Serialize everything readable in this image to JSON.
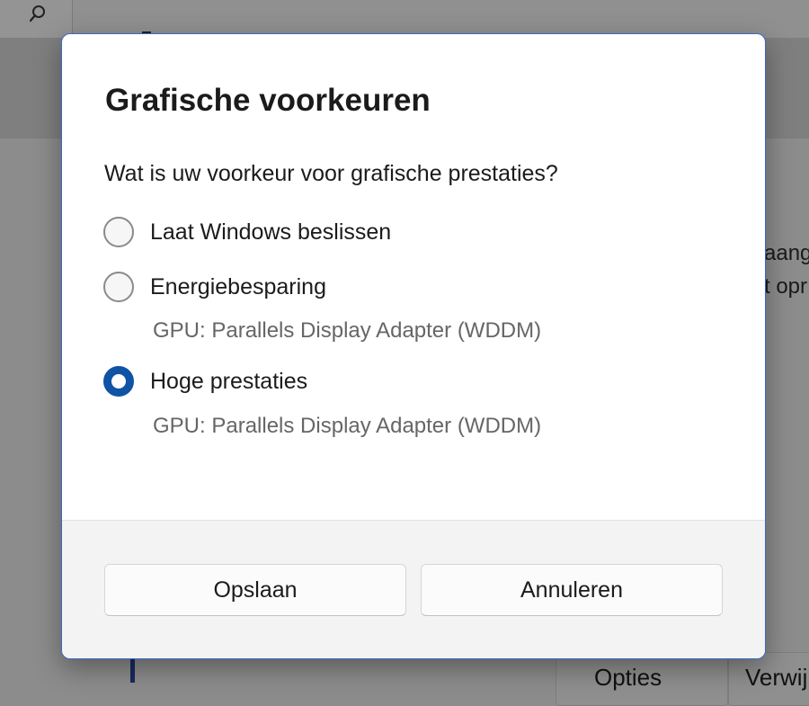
{
  "background": {
    "partial_texts": [
      "aang",
      "t opr"
    ],
    "bottom_buttons": [
      "Opties",
      "Verwij"
    ]
  },
  "dialog": {
    "title": "Grafische voorkeuren",
    "question": "Wat is uw voorkeur voor grafische prestaties?",
    "options": [
      {
        "label": "Laat Windows beslissen",
        "selected": false
      },
      {
        "label": "Energiebesparing",
        "selected": false,
        "gpu": "GPU: Parallels Display Adapter (WDDM)"
      },
      {
        "label": "Hoge prestaties",
        "selected": true,
        "gpu": "GPU: Parallels Display Adapter (WDDM)"
      }
    ],
    "buttons": {
      "save": "Opslaan",
      "cancel": "Annuleren"
    },
    "accent_color": "#0f53a6"
  }
}
